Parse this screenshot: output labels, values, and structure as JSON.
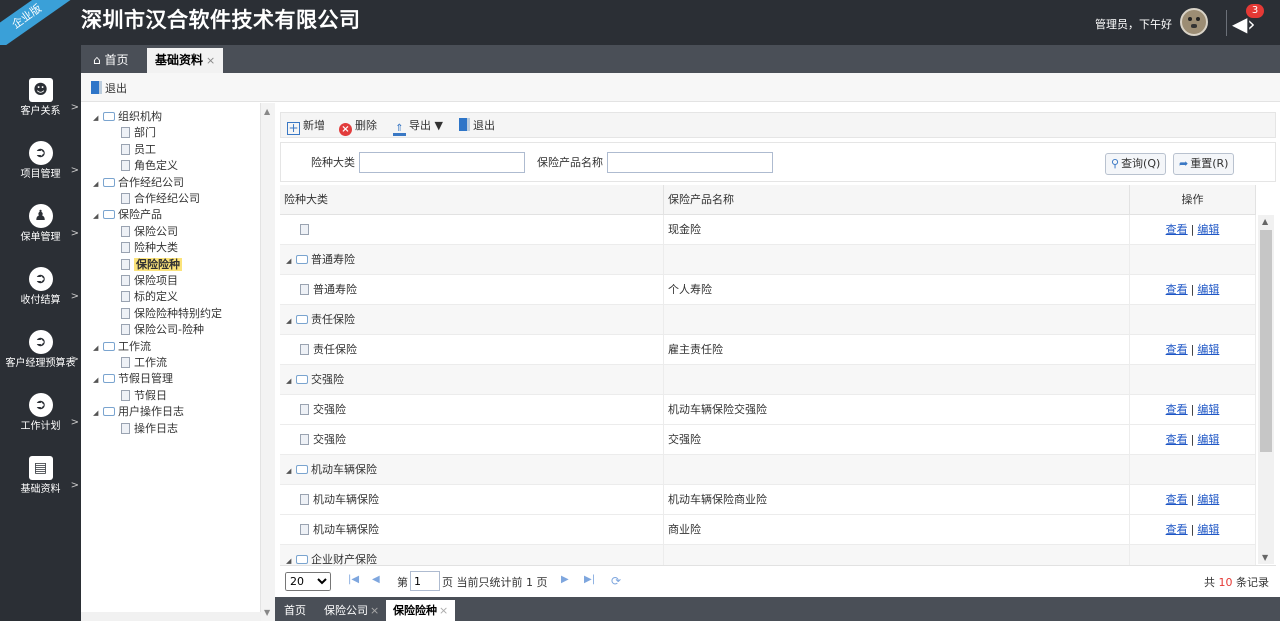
{
  "header": {
    "ribbon": "企业版",
    "company": "深圳市汉合软件技术有限公司",
    "greeting": "管理员，下午好",
    "notification_count": "3"
  },
  "leftnav": [
    {
      "label": "客户关系",
      "icon": "user-icon"
    },
    {
      "label": "项目管理",
      "icon": "login-icon"
    },
    {
      "label": "保单管理",
      "icon": "person-icon"
    },
    {
      "label": "收付结算",
      "icon": "login-icon"
    },
    {
      "label": "客户经理预算表",
      "icon": "login-icon"
    },
    {
      "label": "工作计划",
      "icon": "login-icon"
    },
    {
      "label": "基础资料",
      "icon": "document-icon"
    }
  ],
  "tabs": {
    "home": "首页",
    "active": "基础资料"
  },
  "subbar": {
    "exit": "退出"
  },
  "tree": [
    {
      "label": "组织机构",
      "level": 0,
      "type": "folder"
    },
    {
      "label": "部门",
      "level": 1,
      "type": "doc"
    },
    {
      "label": "员工",
      "level": 1,
      "type": "doc"
    },
    {
      "label": "角色定义",
      "level": 1,
      "type": "doc"
    },
    {
      "label": "合作经纪公司",
      "level": 0,
      "type": "folder"
    },
    {
      "label": "合作经纪公司",
      "level": 1,
      "type": "doc"
    },
    {
      "label": "保险产品",
      "level": 0,
      "type": "folder"
    },
    {
      "label": "保险公司",
      "level": 1,
      "type": "doc"
    },
    {
      "label": "险种大类",
      "level": 1,
      "type": "doc"
    },
    {
      "label": "保险险种",
      "level": 1,
      "type": "doc",
      "selected": true
    },
    {
      "label": "保险项目",
      "level": 1,
      "type": "doc"
    },
    {
      "label": "标的定义",
      "level": 1,
      "type": "doc"
    },
    {
      "label": "保险险种特别约定",
      "level": 1,
      "type": "doc"
    },
    {
      "label": "保险公司-险种",
      "level": 1,
      "type": "doc"
    },
    {
      "label": "工作流",
      "level": 0,
      "type": "folder"
    },
    {
      "label": "工作流",
      "level": 1,
      "type": "doc"
    },
    {
      "label": "节假日管理",
      "level": 0,
      "type": "folder"
    },
    {
      "label": "节假日",
      "level": 1,
      "type": "doc"
    },
    {
      "label": "用户操作日志",
      "level": 0,
      "type": "folder"
    },
    {
      "label": "操作日志",
      "level": 1,
      "type": "doc"
    }
  ],
  "toolbar": {
    "add": "新增",
    "delete": "删除",
    "export": "导出",
    "exit": "退出"
  },
  "search": {
    "category_label": "险种大类",
    "category_value": "",
    "product_label": "保险产品名称",
    "product_value": "",
    "query": "查询(Q)",
    "reset": "重置(R)"
  },
  "grid": {
    "columns": [
      "险种大类",
      "保险产品名称",
      "操作"
    ],
    "view": "查看",
    "edit": "编辑",
    "rows": [
      {
        "group": false,
        "category": "",
        "product": "现金险"
      },
      {
        "group": true,
        "category": "普通寿险"
      },
      {
        "group": false,
        "category": "普通寿险",
        "product": "个人寿险"
      },
      {
        "group": true,
        "category": "责任保险"
      },
      {
        "group": false,
        "category": "责任保险",
        "product": "雇主责任险"
      },
      {
        "group": true,
        "category": "交强险"
      },
      {
        "group": false,
        "category": "交强险",
        "product": "机动车辆保险交强险"
      },
      {
        "group": false,
        "category": "交强险",
        "product": "交强险"
      },
      {
        "group": true,
        "category": "机动车辆保险"
      },
      {
        "group": false,
        "category": "机动车辆保险",
        "product": "机动车辆保险商业险"
      },
      {
        "group": false,
        "category": "机动车辆保险",
        "product": "商业险"
      },
      {
        "group": true,
        "category": "企业财产保险"
      }
    ]
  },
  "pager": {
    "page_size": "20",
    "page_label_prefix": "第",
    "page_value": "1",
    "page_label_suffix": "页 当前只统计前 1 页",
    "total_prefix": "共",
    "total_count": "10",
    "total_suffix": "条记录"
  },
  "bottom_tabs": [
    "首页",
    "保险公司",
    "保险险种"
  ]
}
